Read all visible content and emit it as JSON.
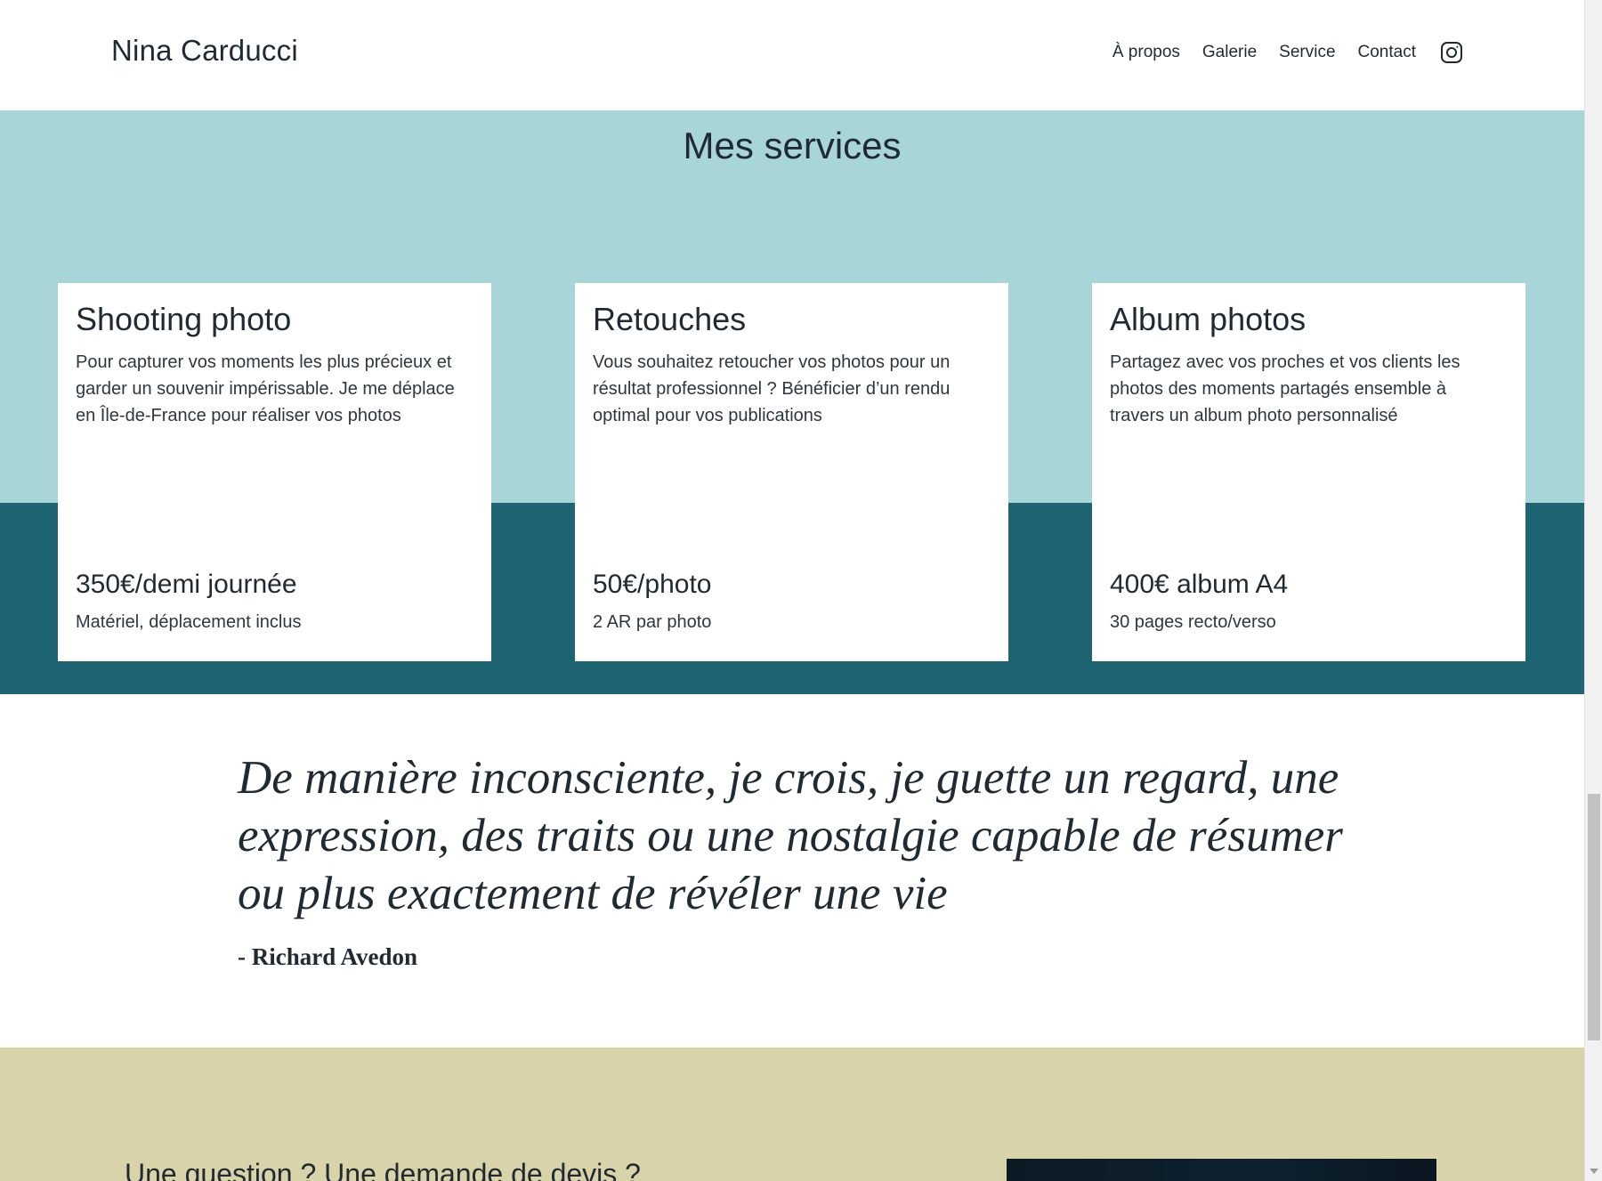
{
  "header": {
    "logo": "Nina Carducci",
    "nav": [
      "À propos",
      "Galerie",
      "Service",
      "Contact"
    ],
    "instagram_icon": "instagram-icon"
  },
  "services": {
    "title": "Mes services",
    "cards": [
      {
        "title": "Shooting photo",
        "description": "Pour capturer vos moments les plus précieux et garder un souvenir impérissable. Je me déplace en Île-de-France pour réaliser vos photos",
        "price": "350€/demi journée",
        "note": "Matériel, déplacement inclus"
      },
      {
        "title": "Retouches",
        "description": "Vous souhaitez retoucher vos photos pour un résultat professionnel ? Bénéficier d’un rendu optimal pour vos publications",
        "price": "50€/photo",
        "note": "2 AR par photo"
      },
      {
        "title": "Album photos",
        "description": "Partagez avec vos proches et vos clients les photos des moments partagés ensemble à travers un album photo personnalisé",
        "price": "400€ album A4",
        "note": "30 pages recto/verso"
      }
    ]
  },
  "quote": {
    "text": "De manière inconsciente, je crois, je guette un regard, une expression, des traits ou une nostalgie capable de résumer ou plus exactement de révéler une vie",
    "author": "- Richard Avedon"
  },
  "contact": {
    "title": "Une question ? Une demande de devis ?"
  },
  "colors": {
    "services_light": "#a8d5d8",
    "services_dark": "#1e6473",
    "contact_bg": "#d8d3a8",
    "text": "#1f2a33"
  }
}
